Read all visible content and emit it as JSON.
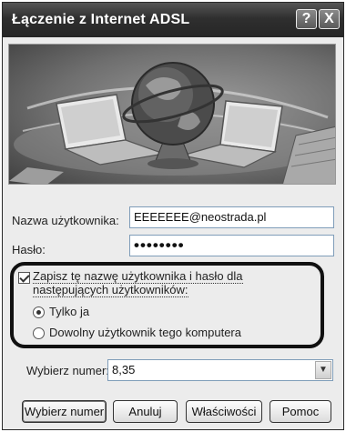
{
  "window": {
    "title": "Łączenie z Internet ADSL",
    "help_glyph": "?",
    "close_glyph": "X"
  },
  "form": {
    "username_label": "Nazwa użytkownika:",
    "username_value": "EEEEEEE@neostrada.pl",
    "password_label": "Hasło:",
    "password_value": "••••••••"
  },
  "save_credentials": {
    "checked": true,
    "label": "Zapisz tę nazwę użytkownika i hasło dla następujących użytkowników:",
    "options": [
      {
        "label": "Tylko ja",
        "selected": true
      },
      {
        "label": "Dowolny użytkownik tego komputera",
        "selected": false
      }
    ]
  },
  "dial": {
    "label": "Wybierz numer:",
    "value": "8,35",
    "dropdown_glyph": "▼"
  },
  "buttons": {
    "dial": "Wybierz numer",
    "cancel": "Anuluj",
    "properties": "Właściwości",
    "help": "Pomoc"
  },
  "colors": {
    "titlebar": "#2f2f2f",
    "dialog_bg": "#ececec",
    "field_border": "#7f9db9",
    "highlight": "#111111"
  }
}
